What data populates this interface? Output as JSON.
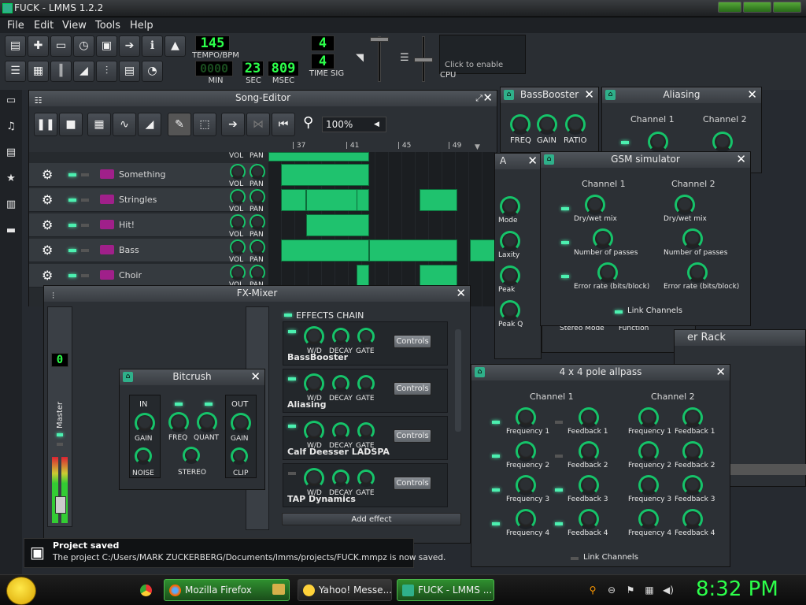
{
  "window": {
    "title": "FUCK - LMMS 1.2.2"
  },
  "menu": [
    "File",
    "Edit",
    "View",
    "Tools",
    "Help"
  ],
  "toolbar": {
    "tempo": "145",
    "tempo_label": "TEMPO/BPM",
    "min": "0000",
    "sec": "23",
    "msec": "809",
    "min_label": "MIN",
    "sec_label": "SEC",
    "msec_label": "MSEC",
    "timesig_top": "4",
    "timesig_bottom": "4",
    "timesig_label": "TIME SIG",
    "cpu_hint": "Click to enable",
    "cpu_label": "CPU"
  },
  "song_editor": {
    "title": "Song-Editor",
    "zoom": "100%",
    "bars": [
      "| 37",
      "| 41",
      "| 45",
      "| 49"
    ],
    "vol_label": "VOL",
    "pan_label": "PAN",
    "tracks": [
      "Something",
      "Stringles",
      "Hit!",
      "Bass",
      "Choir"
    ]
  },
  "fx_mixer": {
    "title": "FX-Mixer",
    "master_label": "Master",
    "channel_display": "0",
    "effects_chain_label": "EFFECTS CHAIN",
    "add_effect": "Add effect",
    "controls_label": "Controls",
    "knob_wd": "W/D",
    "knob_decay": "DECAY",
    "knob_gate": "GATE",
    "effects": [
      "BassBooster",
      "Aliasing",
      "Calf Deesser LADSPA",
      "TAP Dynamics"
    ]
  },
  "bitcrush": {
    "title": "Bitcrush",
    "in_label": "IN",
    "out_label": "OUT",
    "gain": "GAIN",
    "noise": "NOISE",
    "freq": "FREQ",
    "quant": "QUANT",
    "stereo": "STEREO",
    "clip": "CLIP"
  },
  "bassbooster": {
    "title": "BassBooster",
    "freq": "FREQ",
    "gain": "GAIN",
    "ratio": "RATIO"
  },
  "aliasing": {
    "title": "Aliasing",
    "ch1": "Channel 1",
    "ch2": "Channel 2"
  },
  "gsm": {
    "title": "GSM simulator",
    "ch1": "Channel 1",
    "ch2": "Channel 2",
    "drywet": "Dry/wet mix",
    "passes": "Number of passes",
    "error": "Error rate (bits/block)",
    "link": "Link Channels"
  },
  "partial_left": {
    "a": "A",
    "mode": "Mode",
    "laxity": "Laxity",
    "peak": "Peak",
    "peakq": "Peak Q",
    "stereo_mode": "Stereo Mode",
    "function": "Function"
  },
  "rack_partial": {
    "label": "er Rack"
  },
  "allpass": {
    "title": "4 x 4 pole allpass",
    "ch1": "Channel 1",
    "ch2": "Channel 2",
    "freq": [
      "Frequency 1",
      "Frequency 2",
      "Frequency 3",
      "Frequency 4"
    ],
    "fb": [
      "Feedback 1",
      "Feedback 2",
      "Feedback 3",
      "Feedback 4"
    ],
    "link": "Link Channels"
  },
  "notification": {
    "title": "Project saved",
    "message": "The project C:/Users/MARK ZUCKERBERG/Documents/lmms/projects/FUCK.mmpz is now saved."
  },
  "taskbar": {
    "apps": [
      "Mozilla Firefox",
      "Yahoo! Messe...",
      "FUCK - LMMS ..."
    ],
    "clock": "8:32 PM"
  },
  "colors": {
    "accent": "#1fc26e",
    "lcd": "#2cff4a"
  }
}
